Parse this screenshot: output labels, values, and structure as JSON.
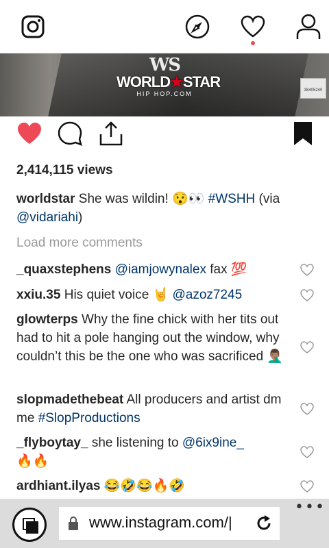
{
  "nav": {
    "icons": [
      "instagram-icon",
      "compass-icon",
      "heart-icon",
      "profile-icon"
    ],
    "notification_color": "#ed4956"
  },
  "media": {
    "watermark_top": "WS",
    "watermark_name_left": "WORLD",
    "watermark_name_right": "STAR",
    "watermark_sub": "HIP HOP.COM",
    "plate_text": "38405240"
  },
  "post": {
    "views": "2,414,115 views",
    "caption_user": "worldstar",
    "caption_text": " She was wildin! 😯👀 ",
    "caption_hashtag": "#WSHH",
    "caption_via": " (via ",
    "caption_mention": "@vidariahi",
    "caption_end": ")",
    "load_more": "Load more comments",
    "liked_color": "#ed4956"
  },
  "comments": [
    {
      "user": "_quaxstephens",
      "pre": " ",
      "link": "@iamjowynalex",
      "text": " fax 💯"
    },
    {
      "user": "xxiu.35",
      "text": " His quiet voice 🤘 ",
      "link": "@azoz7245"
    },
    {
      "user": "glowterps",
      "text": " Why the fine chick with her tits out had to hit a pole hanging out the window, why couldn’t this be the one who was sacrificed 🤦🏽‍♂️"
    },
    {
      "user": "slopmadethebeat",
      "text": " All producers and artist dm me ",
      "link": "#SlopProductions"
    },
    {
      "user": "_flyboytay_",
      "text": " she listening to ",
      "link": "@6ix9ine_",
      "text2": "🔥🔥"
    },
    {
      "user": "ardhiant.ilyas",
      "text": " 😂🤣😂🔥🤣"
    }
  ],
  "browser": {
    "url": "www.instagram.com/|",
    "more": "•••"
  }
}
